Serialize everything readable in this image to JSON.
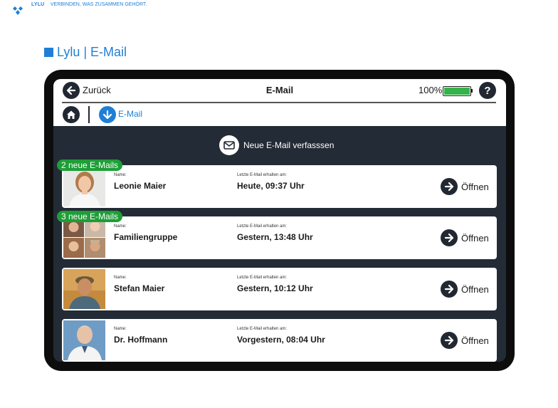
{
  "brand": {
    "name": "LYLU",
    "tagline": "VERBINDEN, WAS ZUSAMMEN GEHÖRT.",
    "logo_icon": "diamond-logo-icon"
  },
  "page": {
    "title": "Lylu | E-Mail"
  },
  "app": {
    "header": {
      "back_label": "Zurück",
      "title": "E-Mail",
      "battery_percent_label": "100%",
      "battery_level": 1.0,
      "help_label": "?"
    },
    "breadcrumb": {
      "current": "E-Mail"
    },
    "compose": {
      "label": "Neue E-Mail verfasssen"
    },
    "labels": {
      "name": "Name:",
      "last_received": "Letzte E-Mail erhalten am:",
      "open": "Öffnen"
    },
    "contacts": [
      {
        "name": "Leonie Maier",
        "last": "Heute, 09:37 Uhr",
        "badge": "2 neue E-Mails",
        "avatar": "woman-portrait"
      },
      {
        "name": "Familiengruppe",
        "last": "Gestern, 13:48 Uhr",
        "badge": "3 neue E-Mails",
        "avatar": "group-photo-grid"
      },
      {
        "name": "Stefan Maier",
        "last": "Gestern, 10:12 Uhr",
        "badge": "",
        "avatar": "man-cap-portrait"
      },
      {
        "name": "Dr. Hoffmann",
        "last": "Vorgestern, 08:04 Uhr",
        "badge": "",
        "avatar": "doctor-portrait"
      }
    ]
  },
  "colors": {
    "accent": "#1f7fd6",
    "badge": "#1e9e37",
    "screen_bg": "#232b36",
    "battery": "#35b34a"
  }
}
